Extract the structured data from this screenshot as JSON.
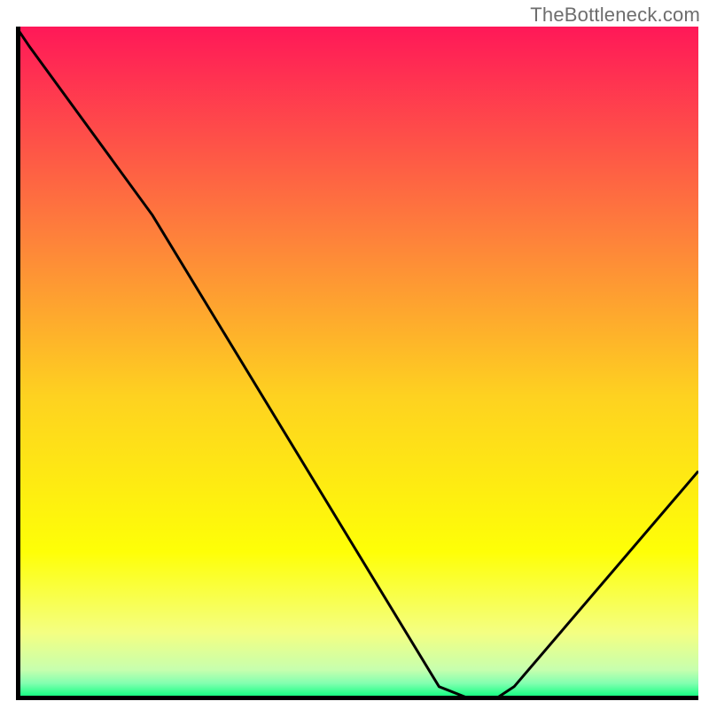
{
  "watermark": "TheBottleneck.com",
  "chart_data": {
    "type": "line",
    "title": "",
    "xlabel": "",
    "ylabel": "",
    "x": [
      0.0,
      0.02,
      0.2,
      0.62,
      0.67,
      0.7,
      0.73,
      1.0
    ],
    "values": [
      1.0,
      0.97,
      0.72,
      0.02,
      0.0,
      0.0,
      0.02,
      0.34
    ],
    "xlim": [
      0,
      1
    ],
    "ylim": [
      0,
      1
    ],
    "marker": {
      "x": 0.685,
      "y": -0.007,
      "color": "#e2626e"
    },
    "background_gradient": {
      "stops": [
        {
          "offset": 0.0,
          "color": "#ff1858"
        },
        {
          "offset": 0.3,
          "color": "#fe7d3c"
        },
        {
          "offset": 0.55,
          "color": "#fed220"
        },
        {
          "offset": 0.78,
          "color": "#feff07"
        },
        {
          "offset": 0.9,
          "color": "#f4ff82"
        },
        {
          "offset": 0.955,
          "color": "#c7ffae"
        },
        {
          "offset": 0.975,
          "color": "#82ffb0"
        },
        {
          "offset": 0.99,
          "color": "#2bff8b"
        },
        {
          "offset": 1.0,
          "color": "#03ff76"
        }
      ]
    },
    "axis": {
      "color": "#000000",
      "width": 5
    }
  }
}
